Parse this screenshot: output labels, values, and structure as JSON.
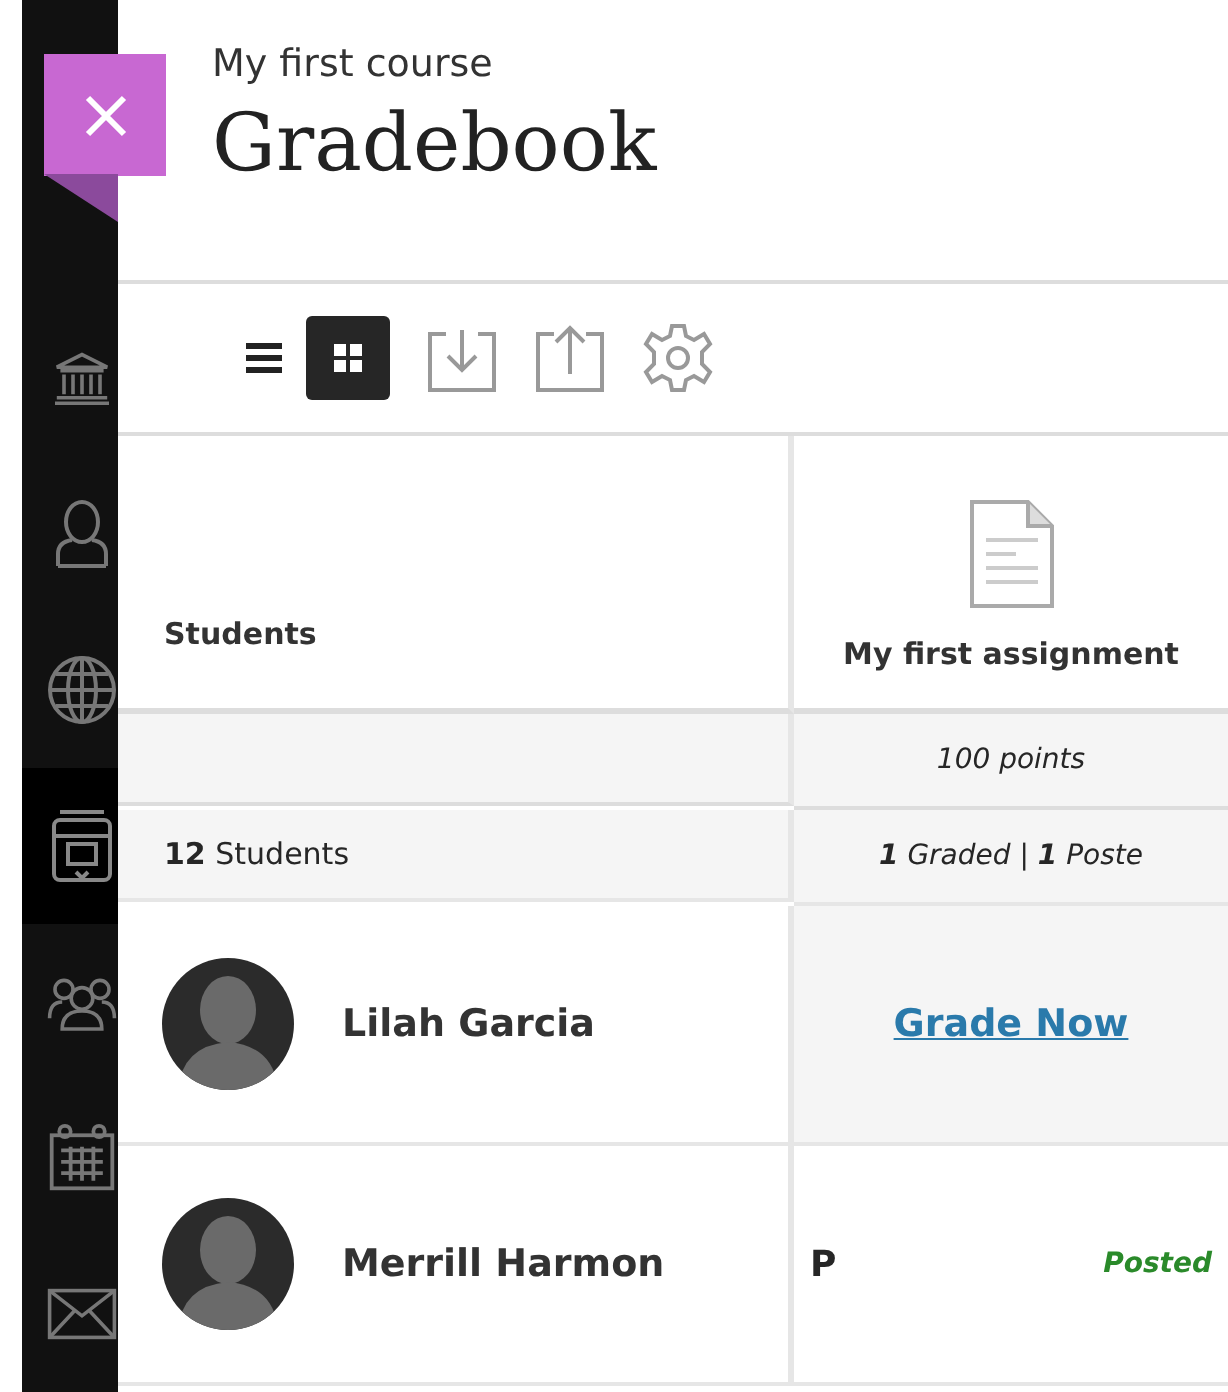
{
  "sidebar": {
    "items": [
      {
        "kind": "institution",
        "selected": false
      },
      {
        "kind": "profile",
        "selected": false
      },
      {
        "kind": "globe",
        "selected": false
      },
      {
        "kind": "courses",
        "selected": true
      },
      {
        "kind": "groups",
        "selected": false
      },
      {
        "kind": "calendar",
        "selected": false
      },
      {
        "kind": "mail",
        "selected": false
      }
    ]
  },
  "header": {
    "course": "My first course",
    "title": "Gradebook"
  },
  "view_toggle": [
    {
      "kind": "list",
      "selected": false
    },
    {
      "kind": "grid",
      "selected": true
    }
  ],
  "table": {
    "student_column": "Students",
    "assignment": {
      "title": "My first assignment",
      "points": "100 points"
    },
    "summary": {
      "students": "**12** Students",
      "status": "**1** Graded | **1** Poste"
    },
    "rows": [
      {
        "name": "Lilah Garcia",
        "grade": {
          "kind": "link",
          "text": "Grade Now"
        }
      },
      {
        "name": "Merrill Harmon",
        "grade": {
          "kind": "value",
          "text": "P",
          "status": "Posted"
        }
      }
    ]
  }
}
